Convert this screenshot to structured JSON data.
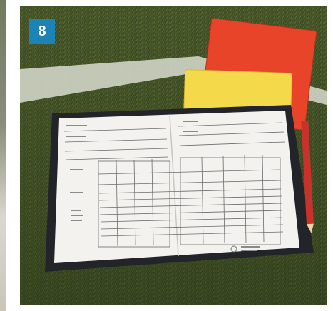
{
  "badge": {
    "number": "8",
    "color": "#1d82b6"
  },
  "photo": {
    "subject": "referee-notebook-with-cards",
    "cards": [
      "red-card",
      "yellow-card"
    ],
    "colors": {
      "grass": "#4a5a2c",
      "red_card": "#e8442a",
      "yellow_card": "#f4d94a",
      "wallet": "#23242a"
    }
  }
}
